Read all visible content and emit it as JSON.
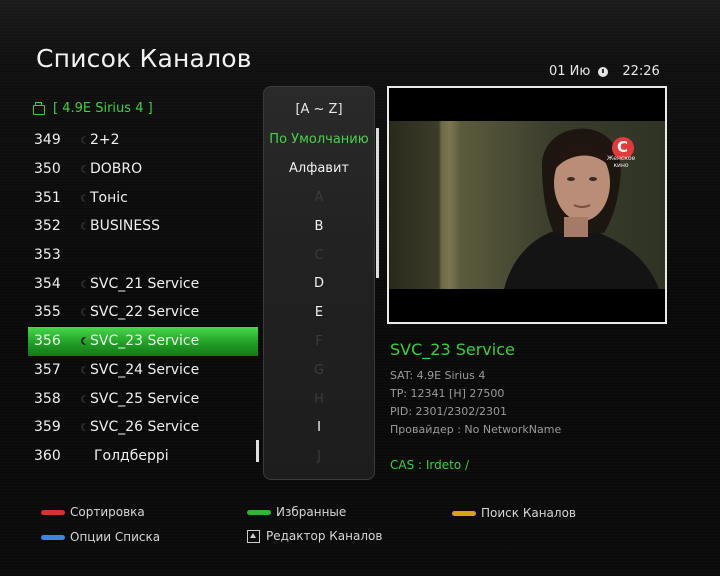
{
  "header": {
    "title": "Список Каналов",
    "date": "01 Ию",
    "time": "22:26"
  },
  "group": {
    "label": "[ 4.9E Sirius 4 ]"
  },
  "channels": [
    {
      "num": "349",
      "name": "2+2",
      "icon": "tv-icon",
      "selected": false
    },
    {
      "num": "350",
      "name": "DOBRO",
      "icon": "tv-icon",
      "selected": false
    },
    {
      "num": "351",
      "name": "Тоніс",
      "icon": "tv-icon",
      "selected": false
    },
    {
      "num": "352",
      "name": "BUSINESS",
      "icon": "tv-icon",
      "selected": false
    },
    {
      "num": "353",
      "name": "",
      "icon": "",
      "selected": false
    },
    {
      "num": "354",
      "name": "SVC_21 Service",
      "icon": "tv-icon",
      "selected": false
    },
    {
      "num": "355",
      "name": "SVC_22 Service",
      "icon": "tv-icon",
      "selected": false
    },
    {
      "num": "356",
      "name": "SVC_23 Service",
      "icon": "tv-icon",
      "selected": true
    },
    {
      "num": "357",
      "name": "SVC_24 Service",
      "icon": "tv-icon",
      "selected": false
    },
    {
      "num": "358",
      "name": "SVC_25 Service",
      "icon": "tv-icon",
      "selected": false
    },
    {
      "num": "359",
      "name": "SVC_26 Service",
      "icon": "tv-icon",
      "selected": false
    },
    {
      "num": "360",
      "name": "Голдберрі",
      "icon": "",
      "selected": false
    }
  ],
  "sort_menu": {
    "range": "[A ~ Z]",
    "default": "По Умолчанию",
    "alphabet": "Алфавит",
    "letters": [
      {
        "ch": "A",
        "active": false
      },
      {
        "ch": "B",
        "active": true
      },
      {
        "ch": "C",
        "active": false
      },
      {
        "ch": "D",
        "active": true
      },
      {
        "ch": "E",
        "active": true
      },
      {
        "ch": "F",
        "active": false
      },
      {
        "ch": "G",
        "active": false
      },
      {
        "ch": "H",
        "active": false
      },
      {
        "ch": "I",
        "active": true
      },
      {
        "ch": "J",
        "active": false
      }
    ]
  },
  "preview": {
    "logo_text": "Женское кино"
  },
  "info": {
    "name": "SVC_23 Service",
    "sat": "SAT: 4.9E Sirius 4",
    "tp": "TP: 12341 [H] 27500",
    "pid": "PID: 2301/2302/2301",
    "provider": "Провайдер : No NetworkName",
    "cas": "CAS : Irdeto /"
  },
  "footer": {
    "red": "Сортировка",
    "green": "Избранные",
    "yellow": "Поиск Каналов",
    "blue": "Опции Списка",
    "edit": "Редактор Каналов"
  },
  "colors": {
    "accent_green": "#37d13c",
    "red_key": "#d93030",
    "green_key": "#2fb82f",
    "yellow_key": "#d8a21a",
    "blue_key": "#3a86e0"
  }
}
